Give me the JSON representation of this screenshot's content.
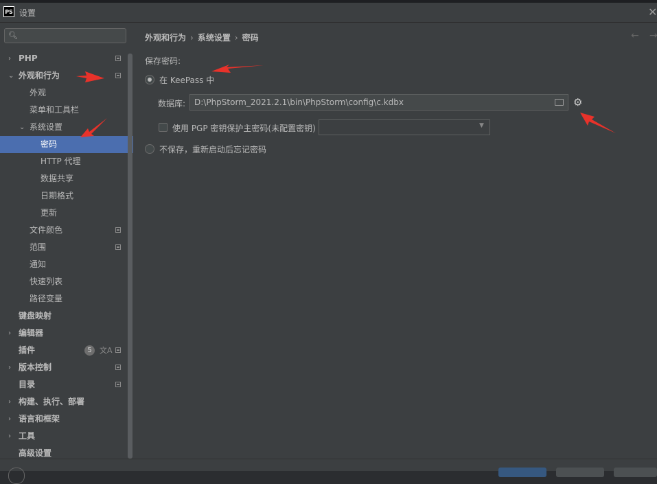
{
  "window": {
    "title": "设置",
    "app_logo": "PS"
  },
  "search": {
    "placeholder": ""
  },
  "sidebar": {
    "items": [
      {
        "label": "PHP",
        "depth": 0,
        "expandable": "collapsed"
      },
      {
        "label": "外观和行为",
        "depth": 0,
        "expandable": "expanded"
      },
      {
        "label": "外观",
        "depth": 1
      },
      {
        "label": "菜单和工具栏",
        "depth": 1
      },
      {
        "label": "系统设置",
        "depth": 1,
        "expandable": "expanded"
      },
      {
        "label": "密码",
        "depth": 2,
        "selected": true
      },
      {
        "label": "HTTP 代理",
        "depth": 2
      },
      {
        "label": "数据共享",
        "depth": 2
      },
      {
        "label": "日期格式",
        "depth": 2
      },
      {
        "label": "更新",
        "depth": 2
      },
      {
        "label": "文件颜色",
        "depth": 1
      },
      {
        "label": "范围",
        "depth": 1
      },
      {
        "label": "通知",
        "depth": 1
      },
      {
        "label": "快速列表",
        "depth": 1
      },
      {
        "label": "路径变量",
        "depth": 1
      },
      {
        "label": "键盘映射",
        "depth": 0
      },
      {
        "label": "编辑器",
        "depth": 0,
        "expandable": "collapsed"
      },
      {
        "label": "插件",
        "depth": 0,
        "badge": "5"
      },
      {
        "label": "版本控制",
        "depth": 0,
        "expandable": "collapsed"
      },
      {
        "label": "目录",
        "depth": 0
      },
      {
        "label": "构建、执行、部署",
        "depth": 0,
        "expandable": "collapsed"
      },
      {
        "label": "语言和框架",
        "depth": 0,
        "expandable": "collapsed"
      },
      {
        "label": "工具",
        "depth": 0,
        "expandable": "collapsed"
      },
      {
        "label": "高级设置",
        "depth": 0
      }
    ]
  },
  "breadcrumb": [
    "外观和行为",
    "系统设置",
    "密码"
  ],
  "main": {
    "section_label": "保存密码:",
    "option_keepass": "在 KeePass 中",
    "database_label": "数据库:",
    "database_path": "D:\\PhpStorm_2021.2.1\\bin\\PhpStorm\\config\\c.kdbx",
    "pgp_label": "使用 PGP 密钥保护主密码(未配置密钥)",
    "pgp_selected": "",
    "option_no_save": "不保存，重新启动后忘记密码"
  },
  "colors": {
    "accent": "#4b6eaf",
    "annotation_arrow": "#e8322a"
  }
}
